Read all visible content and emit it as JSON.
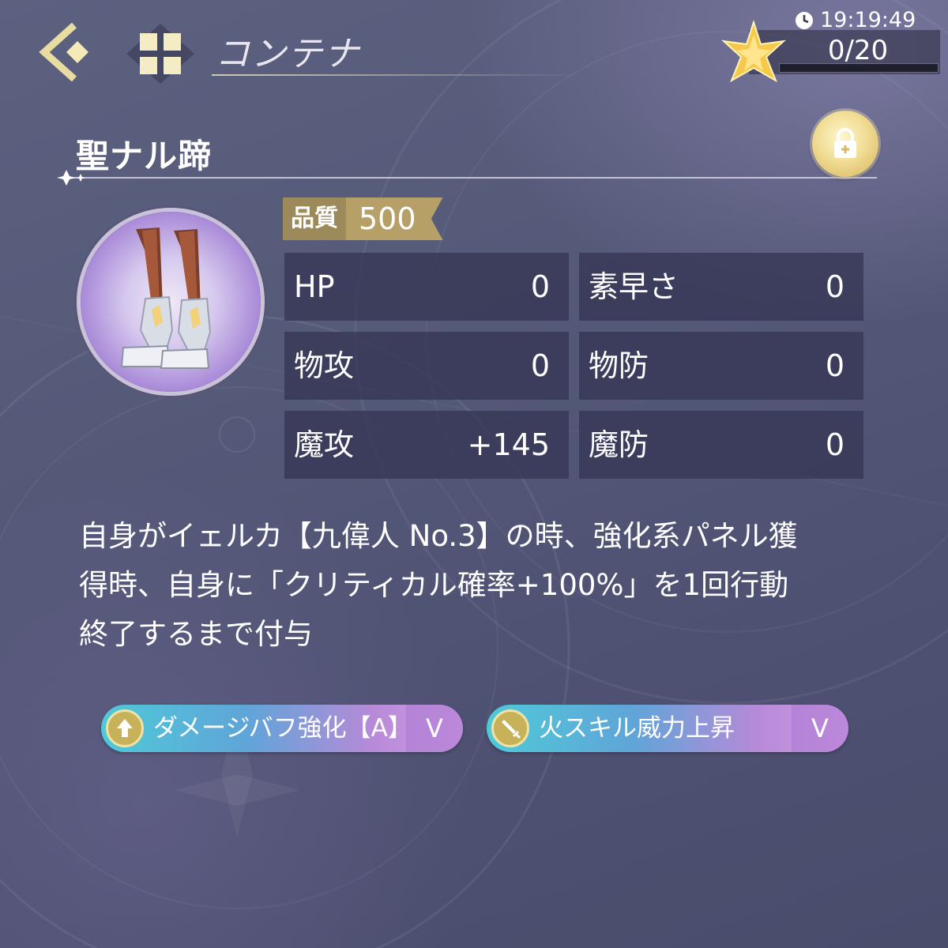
{
  "header": {
    "title": "コンテナ",
    "back_icon": "chevron-left-icon",
    "menu_icon": "grid-icon"
  },
  "status": {
    "time": "19:19:49",
    "stamina": "0/20"
  },
  "item": {
    "name": "聖ナル蹄",
    "quality_label": "品質",
    "quality_value": "500",
    "locked_icon": "lock-icon"
  },
  "stats": [
    {
      "label": "HP",
      "value": "0"
    },
    {
      "label": "素早さ",
      "value": "0"
    },
    {
      "label": "物攻",
      "value": "0"
    },
    {
      "label": "物防",
      "value": "0"
    },
    {
      "label": "魔攻",
      "value": "+145"
    },
    {
      "label": "魔防",
      "value": "0"
    }
  ],
  "description": [
    "自身がイェルカ【九偉人 No.3】の時、強化系パネル獲",
    "得時、自身に「クリティカル確率+100%」を1回行動",
    "終了するまで付与"
  ],
  "skills": [
    {
      "label": "ダメージバフ強化【A】",
      "grade": "V"
    },
    {
      "label": "火スキル威力上昇",
      "grade": "V"
    }
  ],
  "colors": {
    "gold": "#c9b26a",
    "panel": "#36365a",
    "background": "#565a79"
  }
}
